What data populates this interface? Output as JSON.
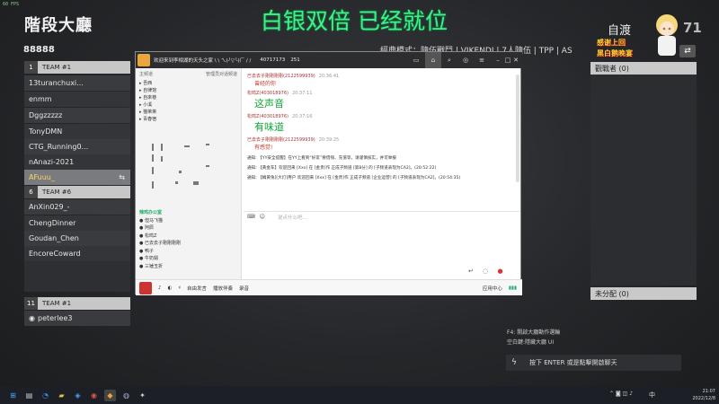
{
  "fps": "60 FPS",
  "lobby_title": "階段大廳",
  "room_code": "88888",
  "overlay_text": "白银双倍 已经就位",
  "game_mode": "經典模式：隨伍戰鬥 | VIKENDI | 7人隨伍 | TPP | AS",
  "streamer_name": "自渡",
  "sticker_text": "感谢上回\n黑白鹅晚宴",
  "count": "71",
  "teams": [
    {
      "num": "1",
      "label": "TEAM #1",
      "players": [
        "13turanchuxi...",
        "enmm",
        "Dggzzzzz",
        "TonyDMN",
        "CTG_Running0...",
        "nAnazi-2021",
        "AFuuu_"
      ],
      "selected": "AFuuu_"
    },
    {
      "num": "6",
      "label": "TEAM #6",
      "players": [
        "AnXin029_-",
        "ChengDinner",
        "Goudan_Chen",
        "EncoreCoward"
      ]
    },
    {
      "num": "11",
      "label": "TEAM #1",
      "players": [
        "peterlee3"
      ]
    }
  ],
  "swap_icon": "⇆",
  "observers_label": "觀戰者 (0)",
  "unassigned_label": "未分配 (0)",
  "keys": [
    "F4: 開啟大廳動作選輪",
    "空白鍵:隱藏大廳 UI"
  ],
  "chat_hint": "按下 ENTER 或是點擊開啟聊天",
  "yy": {
    "title": "欢迎来到李相湖的天头之家 \\ \\ ㄟ(╯▽╰)ㄏ / /",
    "id": "40717173",
    "online": "251",
    "tree_header": [
      "主频道",
      "管理员对话频道"
    ],
    "tree": [
      "吾西",
      "自律馆",
      "自來巷",
      "小溪",
      "猫茉茉",
      "青春宿"
    ],
    "members_header": "辣鸡办公室",
    "members": [
      "但马飞猫",
      "阿辰",
      "松鸣Z",
      "已去去子剛剛剛剛",
      "鸭子",
      "牛奶娟",
      "三锤玉折"
    ],
    "messages": [
      {
        "name": "已去去子剛剛剛剛(2122599939)",
        "time": "20:36:41",
        "text": "曾经的你",
        "big": false
      },
      {
        "name": "松鸣Z(403018976)",
        "time": "20:37:11",
        "text": "这声音",
        "big": true
      },
      {
        "name": "松鸣Z(403018976)",
        "time": "20:37:16",
        "text": "有味道",
        "big": true
      },
      {
        "name": "已去去子剛剛剛剛(2122599939)",
        "time": "20:39:25",
        "text": "有感觉!",
        "big": false
      }
    ],
    "system": [
      "通知: 【YY安全提醒】在YY上看到“好友”要借钱、充值等，请谨慎核实，并可举报",
      "通知: 【黄金车】欢迎回来 [Xxx] 在 [金贵]作 正成子频道 [第8分] 的 [子频道表现为CA2]。(20:52:22)",
      "通知: 【橘黄兔][大灯]用户 欢迎回来 [Xxx] 在 [金贵]作 正成子频道 [企业运营] 的 [子频道表现为CA2]。(20:54:35)"
    ],
    "input_placeholder": "说点什么吧...",
    "bottom": [
      "自由发言",
      "播放伴奏",
      "录音"
    ],
    "bottom_right": "应用中心"
  },
  "taskbar": {
    "time": "21:07",
    "date": "2022/12/8",
    "ime": "中"
  }
}
